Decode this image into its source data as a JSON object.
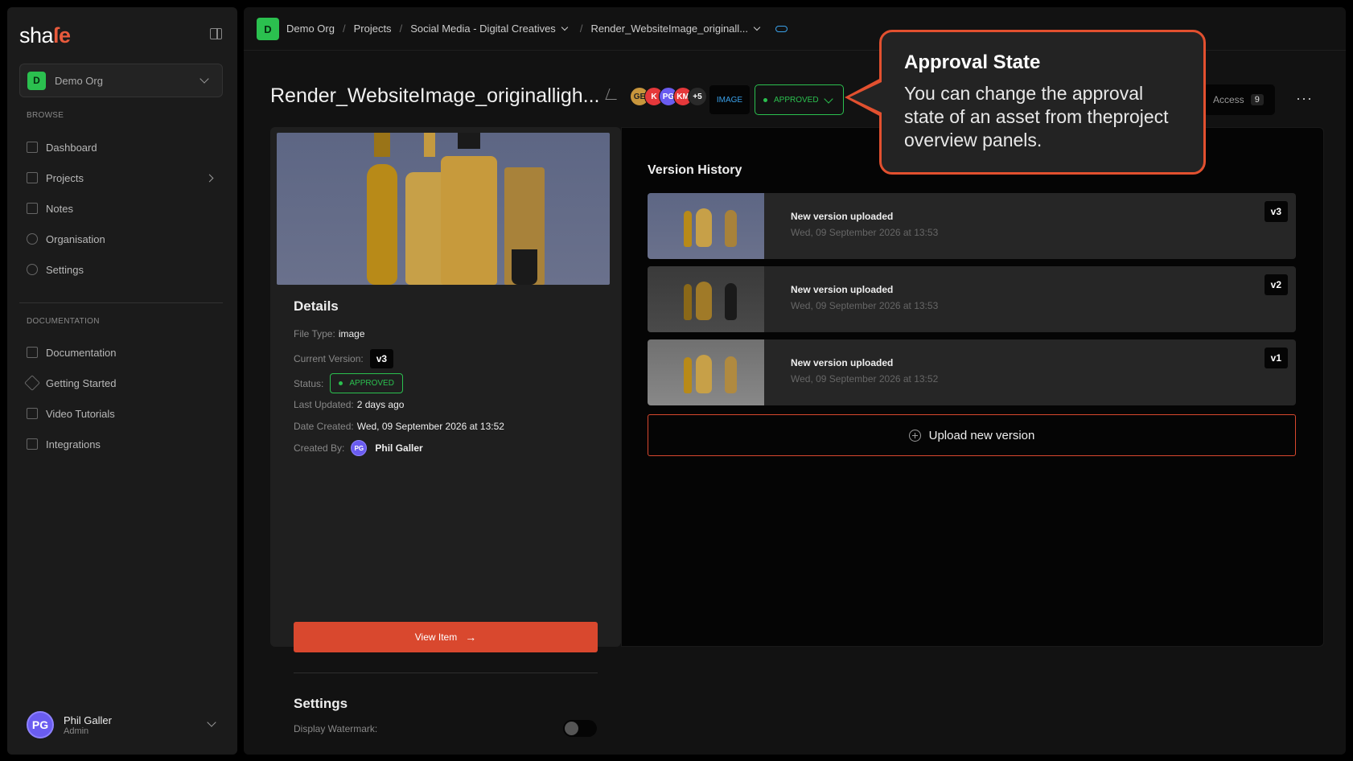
{
  "sidebar": {
    "logo_pre": "sha",
    "logo_accent": "ſe",
    "org": {
      "badge": "D",
      "name": "Demo Org"
    },
    "browse_label": "BROWSE",
    "browse_items": [
      {
        "label": "Dashboard",
        "icon": "grid-icon"
      },
      {
        "label": "Projects",
        "icon": "folders-icon"
      },
      {
        "label": "Notes",
        "icon": "notebook-icon"
      },
      {
        "label": "Organisation",
        "icon": "users-icon"
      },
      {
        "label": "Settings",
        "icon": "gear-icon"
      }
    ],
    "docs_label": "DOCUMENTATION",
    "docs_items": [
      {
        "label": "Documentation",
        "icon": "library-icon"
      },
      {
        "label": "Getting Started",
        "icon": "compass-icon"
      },
      {
        "label": "Video Tutorials",
        "icon": "video-icon"
      },
      {
        "label": "Integrations",
        "icon": "plug-icon"
      }
    ],
    "user": {
      "initials": "PG",
      "name": "Phil Galler",
      "role": "Admin"
    }
  },
  "breadcrumb": {
    "badge": "D",
    "org": "Demo Org",
    "projects": "Projects",
    "project": "Social Media - Digital Creatives",
    "asset": "Render_WebsiteImage_originall..."
  },
  "asset": {
    "title": "Render_WebsiteImage_originalligh...",
    "avatars": [
      {
        "initials": "GE",
        "color": "#c8963c"
      },
      {
        "initials": "K",
        "color": "#e5383b"
      },
      {
        "initials": "PG",
        "color": "#6a5cf0"
      },
      {
        "initials": "KM",
        "color": "#e5383b"
      },
      {
        "initials": "+5",
        "color": "#2a2a2a"
      }
    ],
    "type": "IMAGE",
    "status": "APPROVED",
    "access_label": "Access",
    "access_count": "9",
    "more": "···"
  },
  "details": {
    "title": "Details",
    "file_type_label": "File Type:",
    "file_type": "image",
    "current_version_label": "Current Version:",
    "current_version": "v3",
    "status_label": "Status:",
    "status": "APPROVED",
    "last_updated_label": "Last Updated:",
    "last_updated": "2 days ago",
    "date_created_label": "Date Created:",
    "date_created": "Wed, 09 September 2026 at 13:52",
    "created_by_label": "Created By:",
    "created_by_initials": "PG",
    "created_by": "Phil Galler",
    "view_button": "View Item",
    "arrow": "→",
    "settings_title": "Settings",
    "watermark_label": "Display Watermark:",
    "watermark_on": false
  },
  "versions": {
    "title": "Version History",
    "items": [
      {
        "title": "New version uploaded",
        "date": "Wed, 09 September 2026 at 13:53",
        "badge": "v3"
      },
      {
        "title": "New version uploaded",
        "date": "Wed, 09 September 2026 at 13:53",
        "badge": "v2"
      },
      {
        "title": "New version uploaded",
        "date": "Wed, 09 September 2026 at 13:52",
        "badge": "v1"
      }
    ],
    "upload_button": "Upload new version"
  },
  "tooltip": {
    "title": "Approval State",
    "body": "You can change the approval state of an asset from theproject overview panels."
  },
  "colors": {
    "accent": "#d9482e",
    "approved": "#2bc04f",
    "link": "#3aa0e8"
  }
}
